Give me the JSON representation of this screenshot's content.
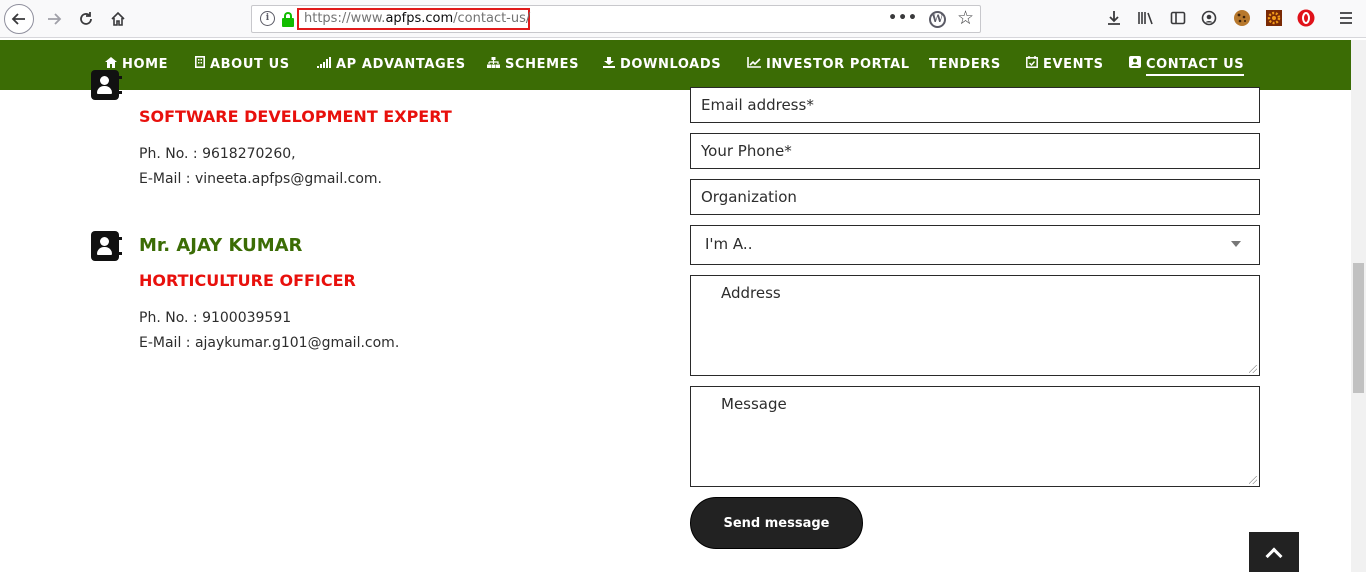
{
  "browser": {
    "url_prefix": "https://www.",
    "url_host": "apfps.com",
    "url_path": "/contact-us/",
    "more_label": "•••"
  },
  "nav": {
    "items": [
      {
        "icon": "home-icon",
        "glyph": "⌂",
        "label": "HOME"
      },
      {
        "icon": "building-icon",
        "glyph": "▮",
        "label": "ABOUT US"
      },
      {
        "icon": "signal-bars-icon",
        "glyph": "▁▃▅",
        "label": "AP ADVANTAGES"
      },
      {
        "icon": "sitemap-icon",
        "glyph": "⊞",
        "label": "SCHEMES"
      },
      {
        "icon": "download-icon",
        "glyph": "⬇",
        "label": "DOWNLOADS"
      },
      {
        "icon": "line-chart-icon",
        "glyph": "↗",
        "label": "INVESTOR PORTAL"
      },
      {
        "icon": "",
        "glyph": "",
        "label": "TENDERS"
      },
      {
        "icon": "calendar-check-icon",
        "glyph": "☑",
        "label": "EVENTS"
      },
      {
        "icon": "contact-card-icon",
        "glyph": "▣",
        "label": "CONTACT US"
      }
    ],
    "active": "CONTACT US",
    "color": "#3b6c05"
  },
  "contacts": [
    {
      "name": "",
      "role": "SOFTWARE DEVELOPMENT EXPERT",
      "phone": "Ph. No. : 9618270260,",
      "email": "E-Mail : vineeta.apfps@gmail.com."
    },
    {
      "name": "Mr. AJAY KUMAR",
      "role": "HORTICULTURE OFFICER",
      "phone": "Ph. No. : 9100039591",
      "email": "E-Mail : ajaykumar.g101@gmail.com."
    }
  ],
  "form": {
    "email_placeholder": "Email address*",
    "phone_placeholder": "Your Phone*",
    "organization_placeholder": "Organization",
    "role_select_value": "I'm A..",
    "address_placeholder": "Address",
    "message_placeholder": "Message",
    "submit_label": "Send message"
  },
  "colors": {
    "name_green": "#3b6c05",
    "role_red": "#e8100c",
    "button_dark": "#222222"
  }
}
